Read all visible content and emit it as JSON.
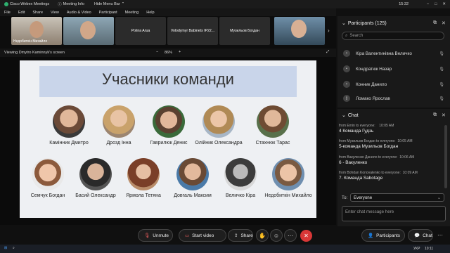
{
  "window": {
    "app_title": "Cisco Webex Meetings",
    "tab_info": "Meeting Info",
    "tab_hide_menu": "Hide Menu Bar",
    "clock": "15:32"
  },
  "menu": [
    "File",
    "Edit",
    "Share",
    "View",
    "Audio & Video",
    "Participant",
    "Meeting",
    "Help"
  ],
  "video_strip": [
    {
      "name": "Недобиткін Михайло"
    },
    {
      "name": ""
    },
    {
      "name": "Polina Arua"
    },
    {
      "name": "Volodymyr Babinets IP22..."
    },
    {
      "name": "Музильов Богдан"
    },
    {
      "name": ""
    }
  ],
  "viewing": {
    "label": "Viewing Dmytro Kaminnyk's screen",
    "zoom": "86%",
    "zoom_minus": "−",
    "zoom_plus": "+"
  },
  "slide": {
    "title": "Учасники команди",
    "members_row1": [
      "Камінник Дмитро",
      "Дрозд Інна",
      "Гаврилюк Денис",
      "Олійник Олександра",
      "Стахнюк Тарас"
    ],
    "members_row2": [
      "Семчук Богдан",
      "Басий Олександр",
      "Ярмола Тетяна",
      "Довгаль Максим",
      "Величко Кіра",
      "Недобиткін Михайло"
    ]
  },
  "participants": {
    "header": "Participants (125)",
    "search_placeholder": "Search",
    "list": [
      {
        "name": "Кіра Валентинівна Величко"
      },
      {
        "name": "Кондратюк Назар"
      },
      {
        "name": "Конник Данило"
      },
      {
        "name": "Ломако Ярослав"
      }
    ]
  },
  "chat": {
    "header": "Chat",
    "messages": [
      {
        "meta": "from Emin to everyone:",
        "time": "10:05 AM",
        "text": "4 Команда Гудзь"
      },
      {
        "meta": "from Музильов Богдан to everyone:",
        "time": "10:05 AM",
        "text": "5-команда Музильов Богдан"
      },
      {
        "meta": "from Вакуленко Данило to everyone:",
        "time": "10:06 AM",
        "text": "6 - Вакуленко"
      },
      {
        "meta": "from Bohdan Konovalenko to everyone:",
        "time": "10:09 AM",
        "text": "7. Команда Sabotage"
      }
    ],
    "to_label": "To:",
    "to_value": "Everyone",
    "input_placeholder": "Enter chat message here"
  },
  "controls": {
    "unmute": "Unmute",
    "start_video": "Start video",
    "share": "Share",
    "participants": "Participants",
    "chat": "Chat"
  },
  "taskbar": {
    "lang": "УКР",
    "time": "10:11"
  },
  "colors": {
    "leave": "#d93737",
    "accent": "#3b7bd6",
    "slide_header": "#c9d5ea"
  }
}
